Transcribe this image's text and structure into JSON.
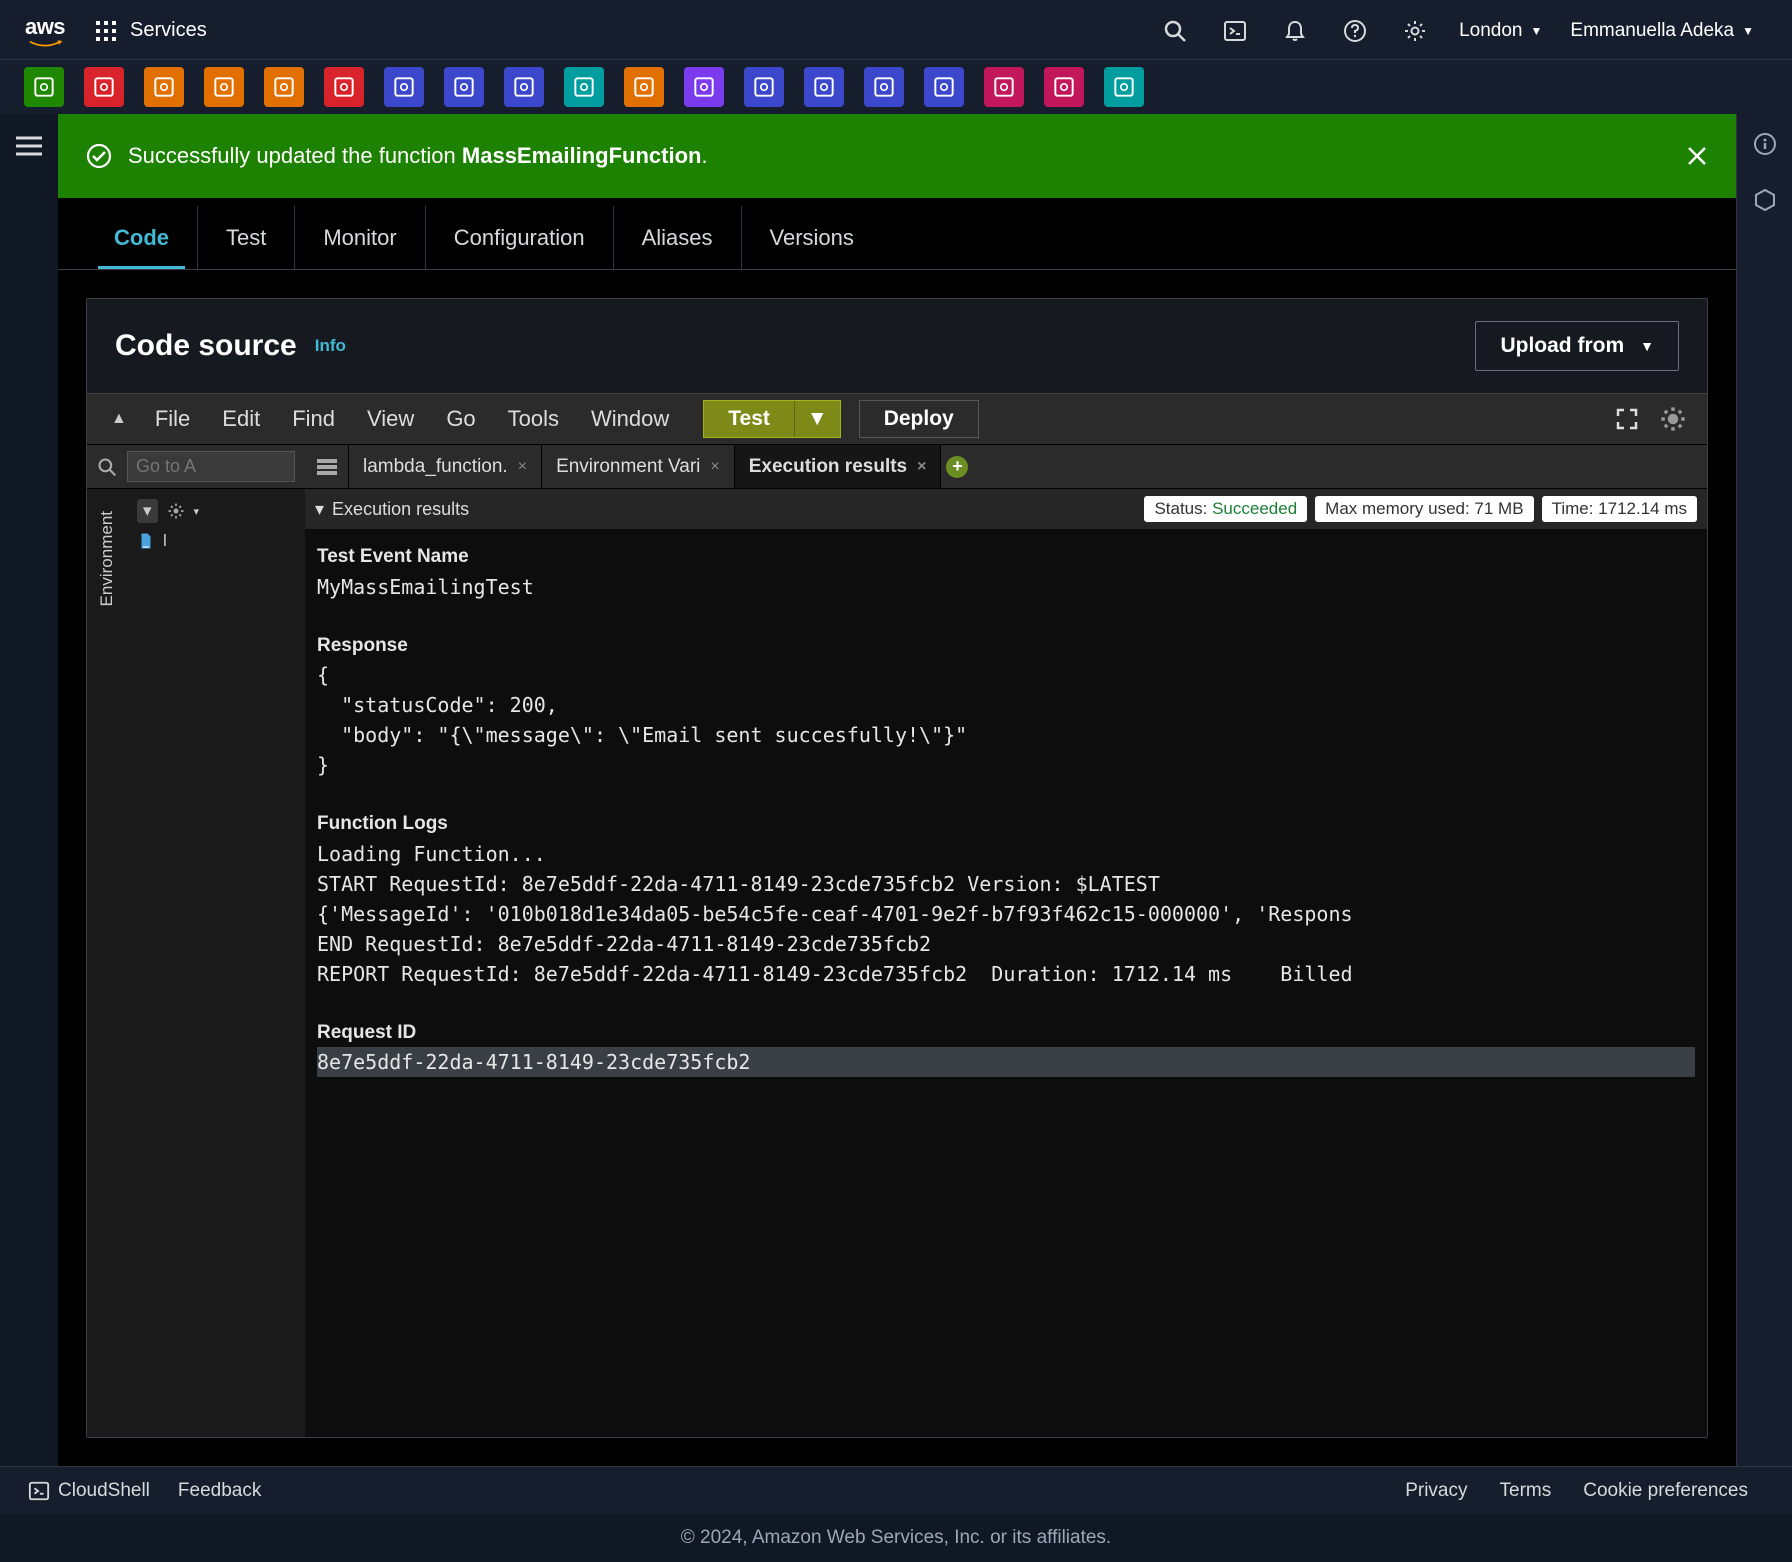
{
  "topnav": {
    "services_label": "Services",
    "region": "London",
    "user": "Emmanuella Adeka"
  },
  "shortcuts": [
    {
      "name": "ses",
      "color": "#1e8900"
    },
    {
      "name": "s3",
      "color": "#d8232a"
    },
    {
      "name": "ec2",
      "color": "#e17000"
    },
    {
      "name": "ecs",
      "color": "#e17000"
    },
    {
      "name": "eks",
      "color": "#e17000"
    },
    {
      "name": "cloudwatch",
      "color": "#d8232a"
    },
    {
      "name": "codebuild",
      "color": "#3b48cc"
    },
    {
      "name": "rds",
      "color": "#3b48cc"
    },
    {
      "name": "dynamodb",
      "color": "#3b48cc"
    },
    {
      "name": "sqs",
      "color": "#009e9e"
    },
    {
      "name": "lambda",
      "color": "#e17000"
    },
    {
      "name": "apigw",
      "color": "#7c3aed"
    },
    {
      "name": "stepfn",
      "color": "#3b48cc"
    },
    {
      "name": "cloudfront",
      "color": "#3b48cc"
    },
    {
      "name": "route53",
      "color": "#3b48cc"
    },
    {
      "name": "vpc",
      "color": "#3b48cc"
    },
    {
      "name": "iam",
      "color": "#c2185b"
    },
    {
      "name": "secrets",
      "color": "#c2185b"
    },
    {
      "name": "kms",
      "color": "#009e9e"
    }
  ],
  "banner": {
    "prefix": "Successfully updated the function ",
    "name": "MassEmailingFunction",
    "suffix": "."
  },
  "tabs": [
    "Code",
    "Test",
    "Monitor",
    "Configuration",
    "Aliases",
    "Versions"
  ],
  "panel": {
    "title": "Code source",
    "info": "Info",
    "upload": "Upload from"
  },
  "ide": {
    "menus": [
      "File",
      "Edit",
      "Find",
      "View",
      "Go",
      "Tools",
      "Window"
    ],
    "test": "Test",
    "deploy": "Deploy",
    "goto_placeholder": "Go to A",
    "env_label": "Environment",
    "tabs": [
      {
        "label": "lambda_function.",
        "active": false
      },
      {
        "label": "Environment Vari",
        "active": false
      },
      {
        "label": "Execution results",
        "active": true
      }
    ],
    "exec_header": "Execution results",
    "badges": {
      "status_label": "Status: ",
      "status_value": "Succeeded",
      "mem_label": "Max memory used: ",
      "mem_value": "71 MB",
      "time_label": "Time: ",
      "time_value": "1712.14 ms"
    },
    "output": {
      "test_event_hdr": "Test Event Name",
      "test_event": "MyMassEmailingTest",
      "response_hdr": "Response",
      "response_lines": "{\n  \"statusCode\": 200,\n  \"body\": \"{\\\"message\\\": \\\"Email sent succesfully!\\\"}\"\n}",
      "logs_hdr": "Function Logs",
      "logs": "Loading Function...\nSTART RequestId: 8e7e5ddf-22da-4711-8149-23cde735fcb2 Version: $LATEST\n{'MessageId': '010b018d1e34da05-be54c5fe-ceaf-4701-9e2f-b7f93f462c15-000000', 'Respons\nEND RequestId: 8e7e5ddf-22da-4711-8149-23cde735fcb2\nREPORT RequestId: 8e7e5ddf-22da-4711-8149-23cde735fcb2  Duration: 1712.14 ms    Billed",
      "reqid_hdr": "Request ID",
      "reqid": "8e7e5ddf-22da-4711-8149-23cde735fcb2"
    }
  },
  "footer": {
    "cloudshell": "CloudShell",
    "feedback": "Feedback",
    "privacy": "Privacy",
    "terms": "Terms",
    "cookie": "Cookie preferences",
    "copyright": "© 2024, Amazon Web Services, Inc. or its affiliates."
  }
}
